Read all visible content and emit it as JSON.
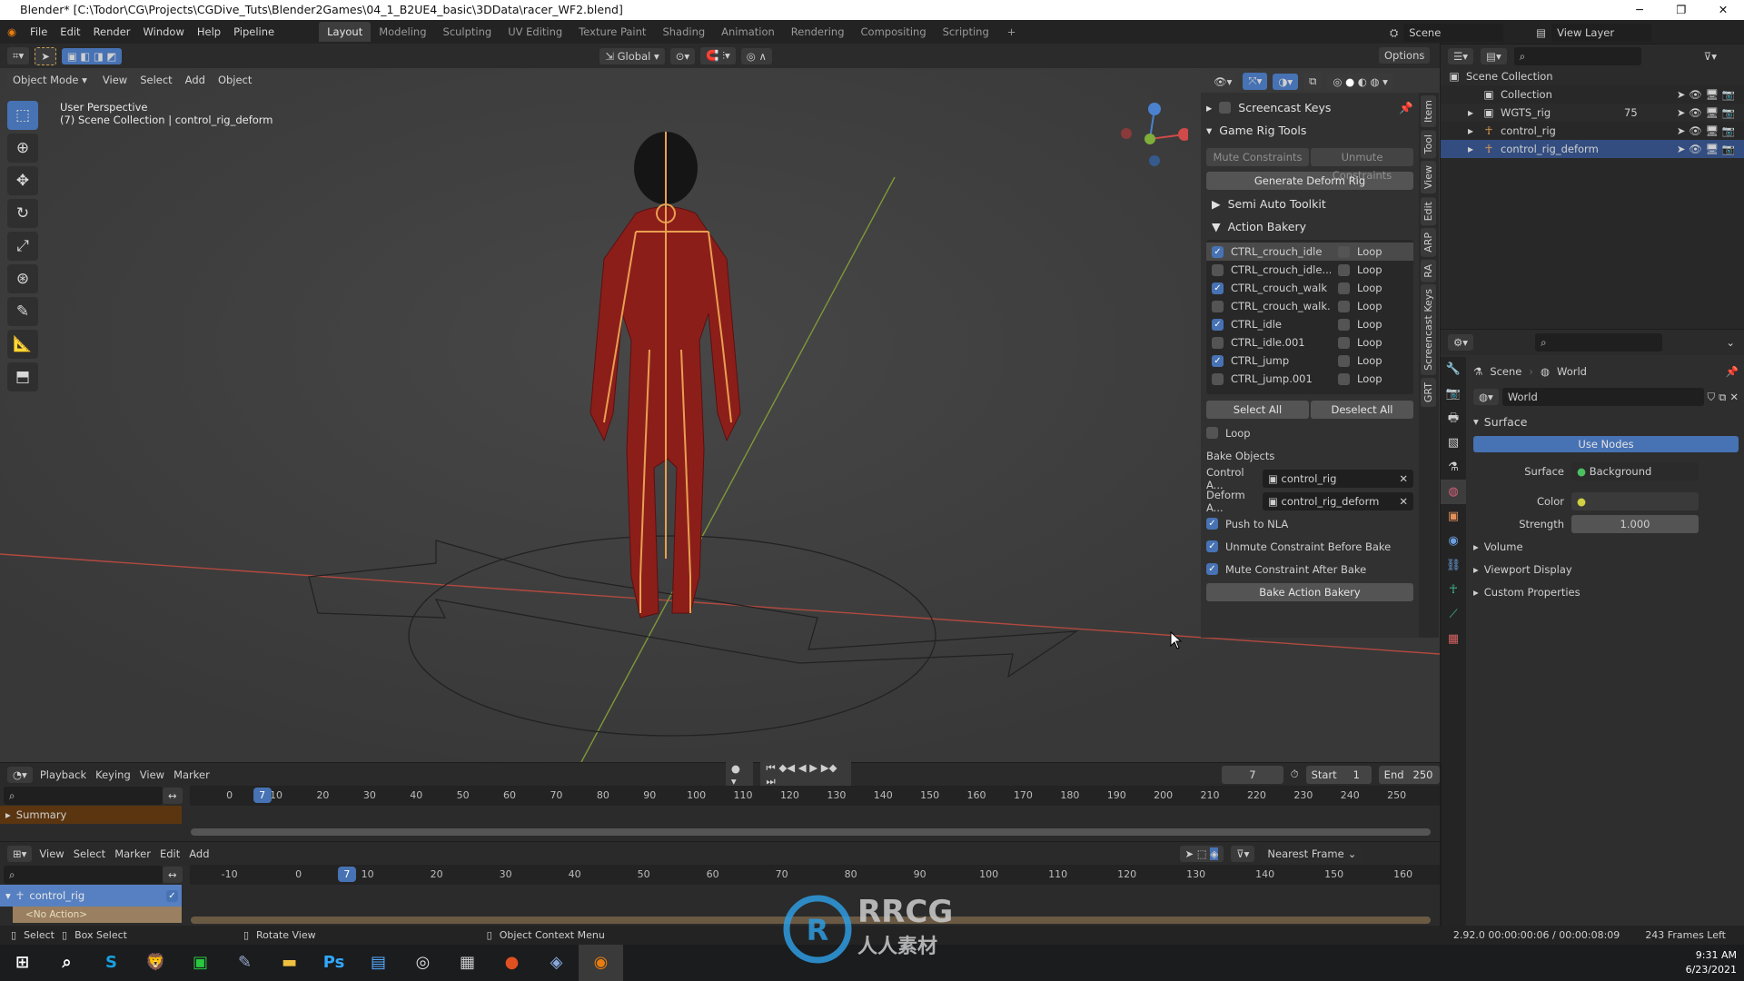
{
  "window": {
    "title": "Blender* [C:\\Todor\\CG\\Projects\\CGDive_Tuts\\Blender2Games\\04_1_B2UE4_basic\\3DData\\racer_WF2.blend]"
  },
  "menubar": {
    "menus": [
      "File",
      "Edit",
      "Render",
      "Window",
      "Help",
      "Pipeline"
    ],
    "workspaces": [
      "Layout",
      "Modeling",
      "Sculpting",
      "UV Editing",
      "Texture Paint",
      "Shading",
      "Animation",
      "Rendering",
      "Compositing",
      "Scripting"
    ],
    "active_workspace": "Layout",
    "scene": "Scene",
    "view_layer": "View Layer"
  },
  "toolheader": {
    "orientation": "Global",
    "options": "Options"
  },
  "viewport": {
    "mode": "Object Mode",
    "menus": [
      "View",
      "Select",
      "Add",
      "Object"
    ],
    "perspective": "User Perspective",
    "collection_info": "(7) Scene Collection | control_rig_deform",
    "colors": {
      "x_axis": "#c0504d",
      "y_axis": "#8ca03c",
      "bone": "#e8a050",
      "mesh": "#8c1e1a"
    }
  },
  "npanel": {
    "screencast_keys": "Screencast Keys",
    "game_rig_tools": "Game Rig Tools",
    "mute_constraints": "Mute Constraints",
    "unmute_constraints": "Unmute Constraints",
    "generate_deform_rig": "Generate Deform Rig",
    "semi_auto_toolkit": "Semi Auto Toolkit",
    "action_bakery": "Action Bakery",
    "actions": [
      {
        "name": "CTRL_crouch_idle",
        "checked": true,
        "loop": false,
        "loop_label": "Loop"
      },
      {
        "name": "CTRL_crouch_idle....",
        "checked": false,
        "loop": false,
        "loop_label": "Loop"
      },
      {
        "name": "CTRL_crouch_walk",
        "checked": true,
        "loop": false,
        "loop_label": "Loop"
      },
      {
        "name": "CTRL_crouch_walk...",
        "checked": false,
        "loop": false,
        "loop_label": "Loop"
      },
      {
        "name": "CTRL_idle",
        "checked": true,
        "loop": false,
        "loop_label": "Loop"
      },
      {
        "name": "CTRL_idle.001",
        "checked": false,
        "loop": false,
        "loop_label": "Loop"
      },
      {
        "name": "CTRL_jump",
        "checked": true,
        "loop": false,
        "loop_label": "Loop"
      },
      {
        "name": "CTRL_jump.001",
        "checked": false,
        "loop": false,
        "loop_label": "Loop"
      }
    ],
    "select_all": "Select All",
    "deselect_all": "Deselect All",
    "loop": "Loop",
    "bake_objects": "Bake Objects",
    "control_label": "Control A...",
    "control_value": "control_rig",
    "deform_label": "Deform A...",
    "deform_value": "control_rig_deform",
    "push_to_nla": "Push to NLA",
    "unmute_before": "Unmute Constraint Before Bake",
    "mute_after": "Mute Constraint After Bake",
    "bake_button": "Bake Action Bakery",
    "tabs": [
      "Item",
      "Tool",
      "View",
      "Edit",
      "ARP",
      "RA",
      "Screencast Keys",
      "GRT"
    ]
  },
  "outliner": {
    "root": "Scene Collection",
    "items": [
      {
        "name": "Collection",
        "icon": "collection-icon",
        "selected": false
      },
      {
        "name": "WGTS_rig",
        "icon": "collection-icon",
        "badge": "75",
        "selected": false
      },
      {
        "name": "control_rig",
        "icon": "armature-icon",
        "selected": false
      },
      {
        "name": "control_rig_deform",
        "icon": "armature-icon",
        "selected": true
      }
    ]
  },
  "properties": {
    "breadcrumb_scene": "Scene",
    "breadcrumb_world": "World",
    "world_name": "World",
    "surface_section": "Surface",
    "use_nodes": "Use Nodes",
    "surface_label": "Surface",
    "surface_value": "Background",
    "color_label": "Color",
    "strength_label": "Strength",
    "strength_value": "1.000",
    "sections": [
      "Volume",
      "Viewport Display",
      "Custom Properties"
    ],
    "accent": "#4772b3"
  },
  "timeline": {
    "menus": [
      "Playback",
      "Keying",
      "View",
      "Marker"
    ],
    "current_frame": "7",
    "start_label": "Start",
    "start": "1",
    "end_label": "End",
    "end": "250",
    "ticks": [
      "0",
      "10",
      "20",
      "30",
      "40",
      "50",
      "60",
      "70",
      "80",
      "90",
      "100",
      "110",
      "120",
      "130",
      "140",
      "150",
      "160",
      "170",
      "180",
      "190",
      "200",
      "210",
      "220",
      "230",
      "240",
      "250"
    ],
    "summary": "Summary"
  },
  "dopesheet": {
    "menus": [
      "View",
      "Select",
      "Marker",
      "Edit",
      "Add"
    ],
    "snap": "Nearest Frame",
    "ticks": [
      "-10",
      "0",
      "10",
      "20",
      "30",
      "40",
      "50",
      "60",
      "70",
      "80",
      "90",
      "100",
      "110",
      "120",
      "130",
      "140",
      "150",
      "160"
    ],
    "current_frame": "7",
    "channel": "control_rig",
    "no_action": "<No Action>"
  },
  "statusbar": {
    "select": "Select",
    "box_select": "Box Select",
    "rotate_view": "Rotate View",
    "context_menu": "Object Context Menu",
    "version_time": "2.92.0  00:00:00:06 / 00:00:08:09",
    "frames_left": "243 Frames Left"
  },
  "taskbar": {
    "time": "9:31 AM",
    "date": "6/23/2021",
    "apps": [
      "start",
      "search",
      "skype",
      "brave",
      "line",
      "notepad",
      "explorer",
      "photoshop",
      "libreoffice",
      "obs",
      "monitor",
      "app",
      "davinci",
      "blender"
    ]
  },
  "watermark": "RRCG 人人素材"
}
